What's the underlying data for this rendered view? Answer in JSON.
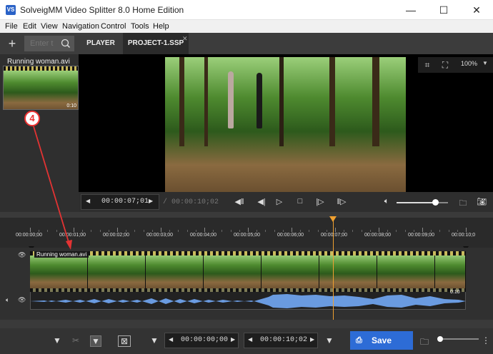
{
  "window": {
    "title": "SolveigMM Video Splitter 8.0 Home Edition",
    "app_icon_text": "VS",
    "minimize": "—",
    "maximize": "☐",
    "close": "✕"
  },
  "menu": [
    "File",
    "Edit",
    "View",
    "Navigation",
    "Control",
    "Tools",
    "Help"
  ],
  "search": {
    "placeholder": "Enter t"
  },
  "tabs": {
    "player": "PLAYER",
    "project": "PROJECT-1.SSP"
  },
  "media_panel": {
    "filename": "Running woman.avi",
    "thumb_duration": "0:10"
  },
  "viewer": {
    "zoom": "100%"
  },
  "playback": {
    "current_time": "00:00:07;01",
    "total_time": "/ 00:00:10;02",
    "volume_level": 0.75
  },
  "ruler_labels": [
    "00:00:00;00",
    "00:00:01;00",
    "00:00:02;00",
    "00:00:03;00",
    "00:00:04;00",
    "00:00:05;00",
    "00:00:06;00",
    "00:00:07;00",
    "00:00:08;00",
    "00:00:09;00",
    "00:00:10;0"
  ],
  "timeline": {
    "clip_name": "Running woman.avi",
    "clip_end": "0:10"
  },
  "bottom": {
    "start_time": "00:00:00;00",
    "end_time": "00:00:10;02",
    "save_label": "Save"
  },
  "annotation": {
    "number": "4"
  },
  "colors": {
    "accent": "#2d6cd6",
    "playhead": "#f0a030",
    "annotation": "#e33333",
    "waveform": "#6a9be0"
  }
}
